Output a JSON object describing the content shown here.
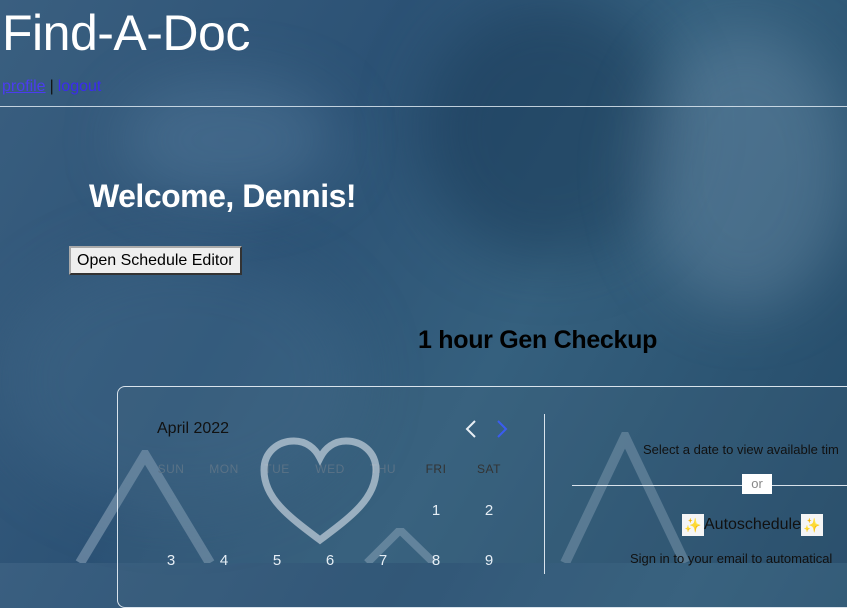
{
  "header": {
    "site_title": "Find-A-Doc",
    "nav": {
      "profile": "profile",
      "separator": "|",
      "logout": "logout"
    }
  },
  "main": {
    "welcome": "Welcome, Dennis!",
    "open_schedule_button": "Open Schedule Editor",
    "event_title": "1 hour Gen Checkup"
  },
  "calendar": {
    "month": "April 2022",
    "prev_icon": "chevron-left-icon",
    "next_icon": "chevron-right-icon",
    "weekdays": [
      "SUN",
      "MON",
      "TUE",
      "WED",
      "THU",
      "FRI",
      "SAT"
    ],
    "week1": [
      "",
      "",
      "",
      "",
      "",
      "1",
      "2"
    ],
    "week2": [
      "3",
      "4",
      "5",
      "6",
      "7",
      "8",
      "9"
    ]
  },
  "side_panel": {
    "select_prompt": "Select a date to view available tim",
    "or": "or",
    "autoschedule": "Autoschedule",
    "sparkle_icon": "sparkles-icon",
    "signin_prompt": "Sign in to your email to automatical"
  },
  "colors": {
    "title": "#ffffff",
    "link": "#3b2af0",
    "border": "#ebf2f8"
  }
}
